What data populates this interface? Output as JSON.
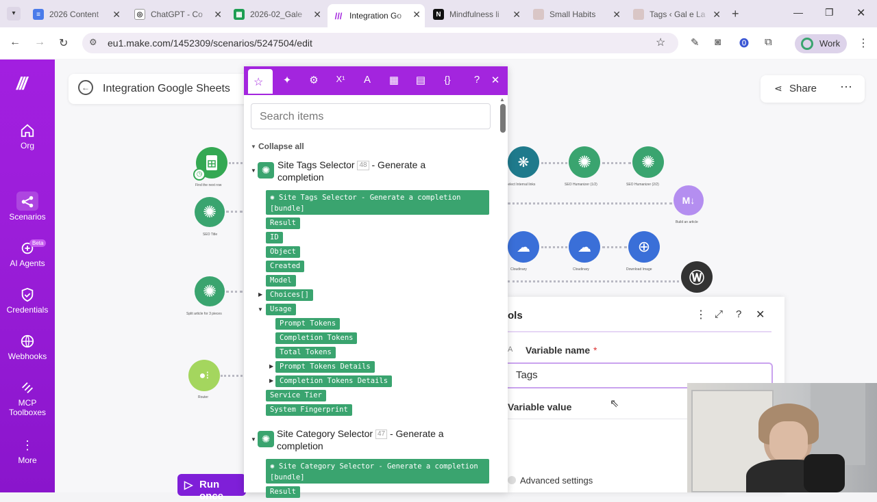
{
  "browser": {
    "tabs": [
      {
        "title": "2026 Content",
        "favicon": "docs-icon"
      },
      {
        "title": "ChatGPT - Co",
        "favicon": "openai-icon"
      },
      {
        "title": "2026-02_Gale",
        "favicon": "sheets-icon"
      },
      {
        "title": "Integration Go",
        "favicon": "make-icon",
        "active": true
      },
      {
        "title": "Mindfulness li",
        "favicon": "notion-icon"
      },
      {
        "title": "Small Habits",
        "favicon": "site-icon"
      },
      {
        "title": "Tags ‹ Gal e La",
        "favicon": "site-icon"
      }
    ],
    "url": "eu1.make.com/1452309/scenarios/5247504/edit",
    "profile_label": "Work"
  },
  "sidebar": {
    "items": [
      {
        "label": "Org",
        "icon": "home-icon"
      },
      {
        "label": "Scenarios",
        "icon": "share-nodes-icon",
        "active": true
      },
      {
        "label": "AI Agents",
        "icon": "ai-agent-icon",
        "badge": "Beta"
      },
      {
        "label": "Credentials",
        "icon": "shield-icon"
      },
      {
        "label": "Webhooks",
        "icon": "globe-icon"
      },
      {
        "label": "MCP Toolboxes",
        "label_line1": "MCP",
        "label_line2": "Toolboxes",
        "icon": "mcp-icon"
      },
      {
        "label": "More",
        "icon": "more-vertical-icon"
      }
    ]
  },
  "header": {
    "scenario_title": "Integration Google Sheets",
    "share_label": "Share"
  },
  "canvas": {
    "nodes": [
      {
        "label": "Find the next row",
        "color": "#34a853"
      },
      {
        "label": "SEO Title",
        "color": "#3aa46f"
      },
      {
        "label": "Split article for 3 pieces",
        "color": "#3aa46f"
      },
      {
        "label": "Router",
        "color": "#a4d65e"
      },
      {
        "label": "Select Internal links",
        "color": "#1f7a8c"
      },
      {
        "label": "SEO Humanizer (1/2)",
        "color": "#3aa46f"
      },
      {
        "label": "SEO Humanizer (2/2)",
        "color": "#3aa46f"
      },
      {
        "label": "Build an article",
        "color": "#b48ef0"
      },
      {
        "label": "Cloudinary",
        "color": "#3a6fd8"
      },
      {
        "label": "Cloudinary",
        "color": "#3a6fd8"
      },
      {
        "label": "Download Image",
        "color": "#3a6fd8"
      },
      {
        "label": "WordPress",
        "color": "#333333"
      }
    ],
    "run_once_label": "Run once"
  },
  "mapping_popup": {
    "search_placeholder": "Search items",
    "collapse_all": "Collapse all",
    "sections": [
      {
        "module": "Site Tags Selector",
        "id": "48",
        "suffix": "- Generate a completion",
        "bundle": "Site Tags Selector - Generate a completion [bundle]",
        "items": [
          "Result",
          "ID",
          "Object",
          "Created",
          "Model",
          "Choices[]",
          "Usage"
        ],
        "usage_items": [
          "Prompt Tokens",
          "Completion Tokens",
          "Total Tokens",
          "Prompt Tokens Details",
          "Completion Tokens Details"
        ],
        "after_items": [
          "Service Tier",
          "System Fingerprint"
        ]
      },
      {
        "module": "Site Category Selector",
        "id": "47",
        "suffix": "- Generate a completion",
        "bundle": "Site Category Selector - Generate a completion [bundle]",
        "items": [
          "Result"
        ]
      }
    ]
  },
  "tools_panel": {
    "title_fragment": "ols",
    "variable_name_label": "Variable name",
    "required_mark": "*",
    "variable_name_value": "Tags",
    "variable_value_label": "Variable value",
    "advanced_settings_label": "Advanced settings"
  }
}
